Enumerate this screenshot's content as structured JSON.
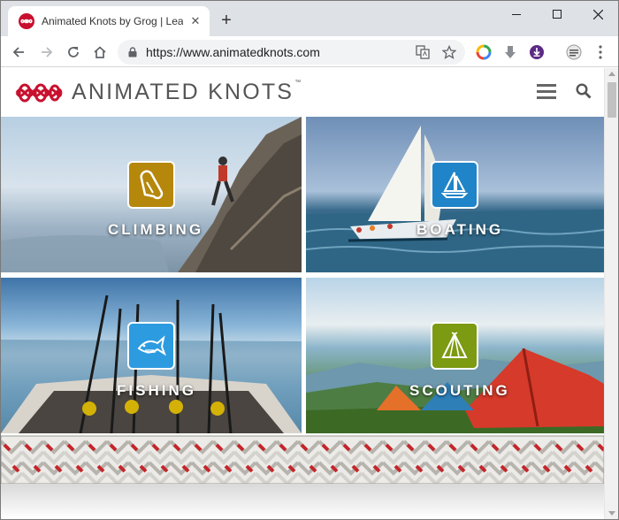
{
  "browser": {
    "tab_title": "Animated Knots by Grog | Learn",
    "tab_close": "✕",
    "new_tab": "+",
    "url": "https://www.animatedknots.com"
  },
  "site": {
    "logo_text": "ANIMATED KNOTS",
    "logo_tm": "™",
    "brand_color": "#c8102e"
  },
  "tiles": [
    {
      "label": "CLIMBING",
      "badge_color": "#b5870b",
      "icon": "carabiner-icon"
    },
    {
      "label": "BOATING",
      "badge_color": "#1f84c8",
      "icon": "sailboat-icon"
    },
    {
      "label": "FISHING",
      "badge_color": "#2d9be0",
      "icon": "fish-icon"
    },
    {
      "label": "SCOUTING",
      "badge_color": "#7c9a12",
      "icon": "tent-icon"
    }
  ]
}
